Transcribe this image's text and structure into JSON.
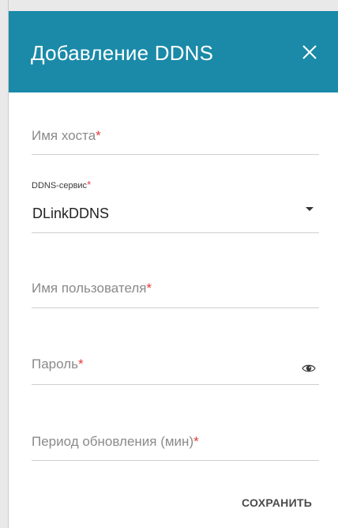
{
  "dialog": {
    "title": "Добавление DDNS",
    "close_icon": "close-icon",
    "header_color": "#1a8aa8"
  },
  "form": {
    "hostname": {
      "placeholder": "Имя хоста",
      "required_mark": "*",
      "value": ""
    },
    "ddns_service": {
      "label": "DDNS-сервис",
      "required_mark": "*",
      "selected": "DLinkDDNS",
      "icon": "chevron-down-icon"
    },
    "username": {
      "placeholder": "Имя пользователя",
      "required_mark": "*",
      "value": ""
    },
    "password": {
      "placeholder": "Пароль",
      "required_mark": "*",
      "value": "",
      "icon": "eye-icon"
    },
    "update_period": {
      "placeholder": "Период обновления (мин)",
      "required_mark": "*",
      "value": ""
    }
  },
  "actions": {
    "save_label": "СОХРАНИТЬ"
  },
  "colors": {
    "required": "#e23b3b",
    "accent": "#1a8aa8"
  }
}
